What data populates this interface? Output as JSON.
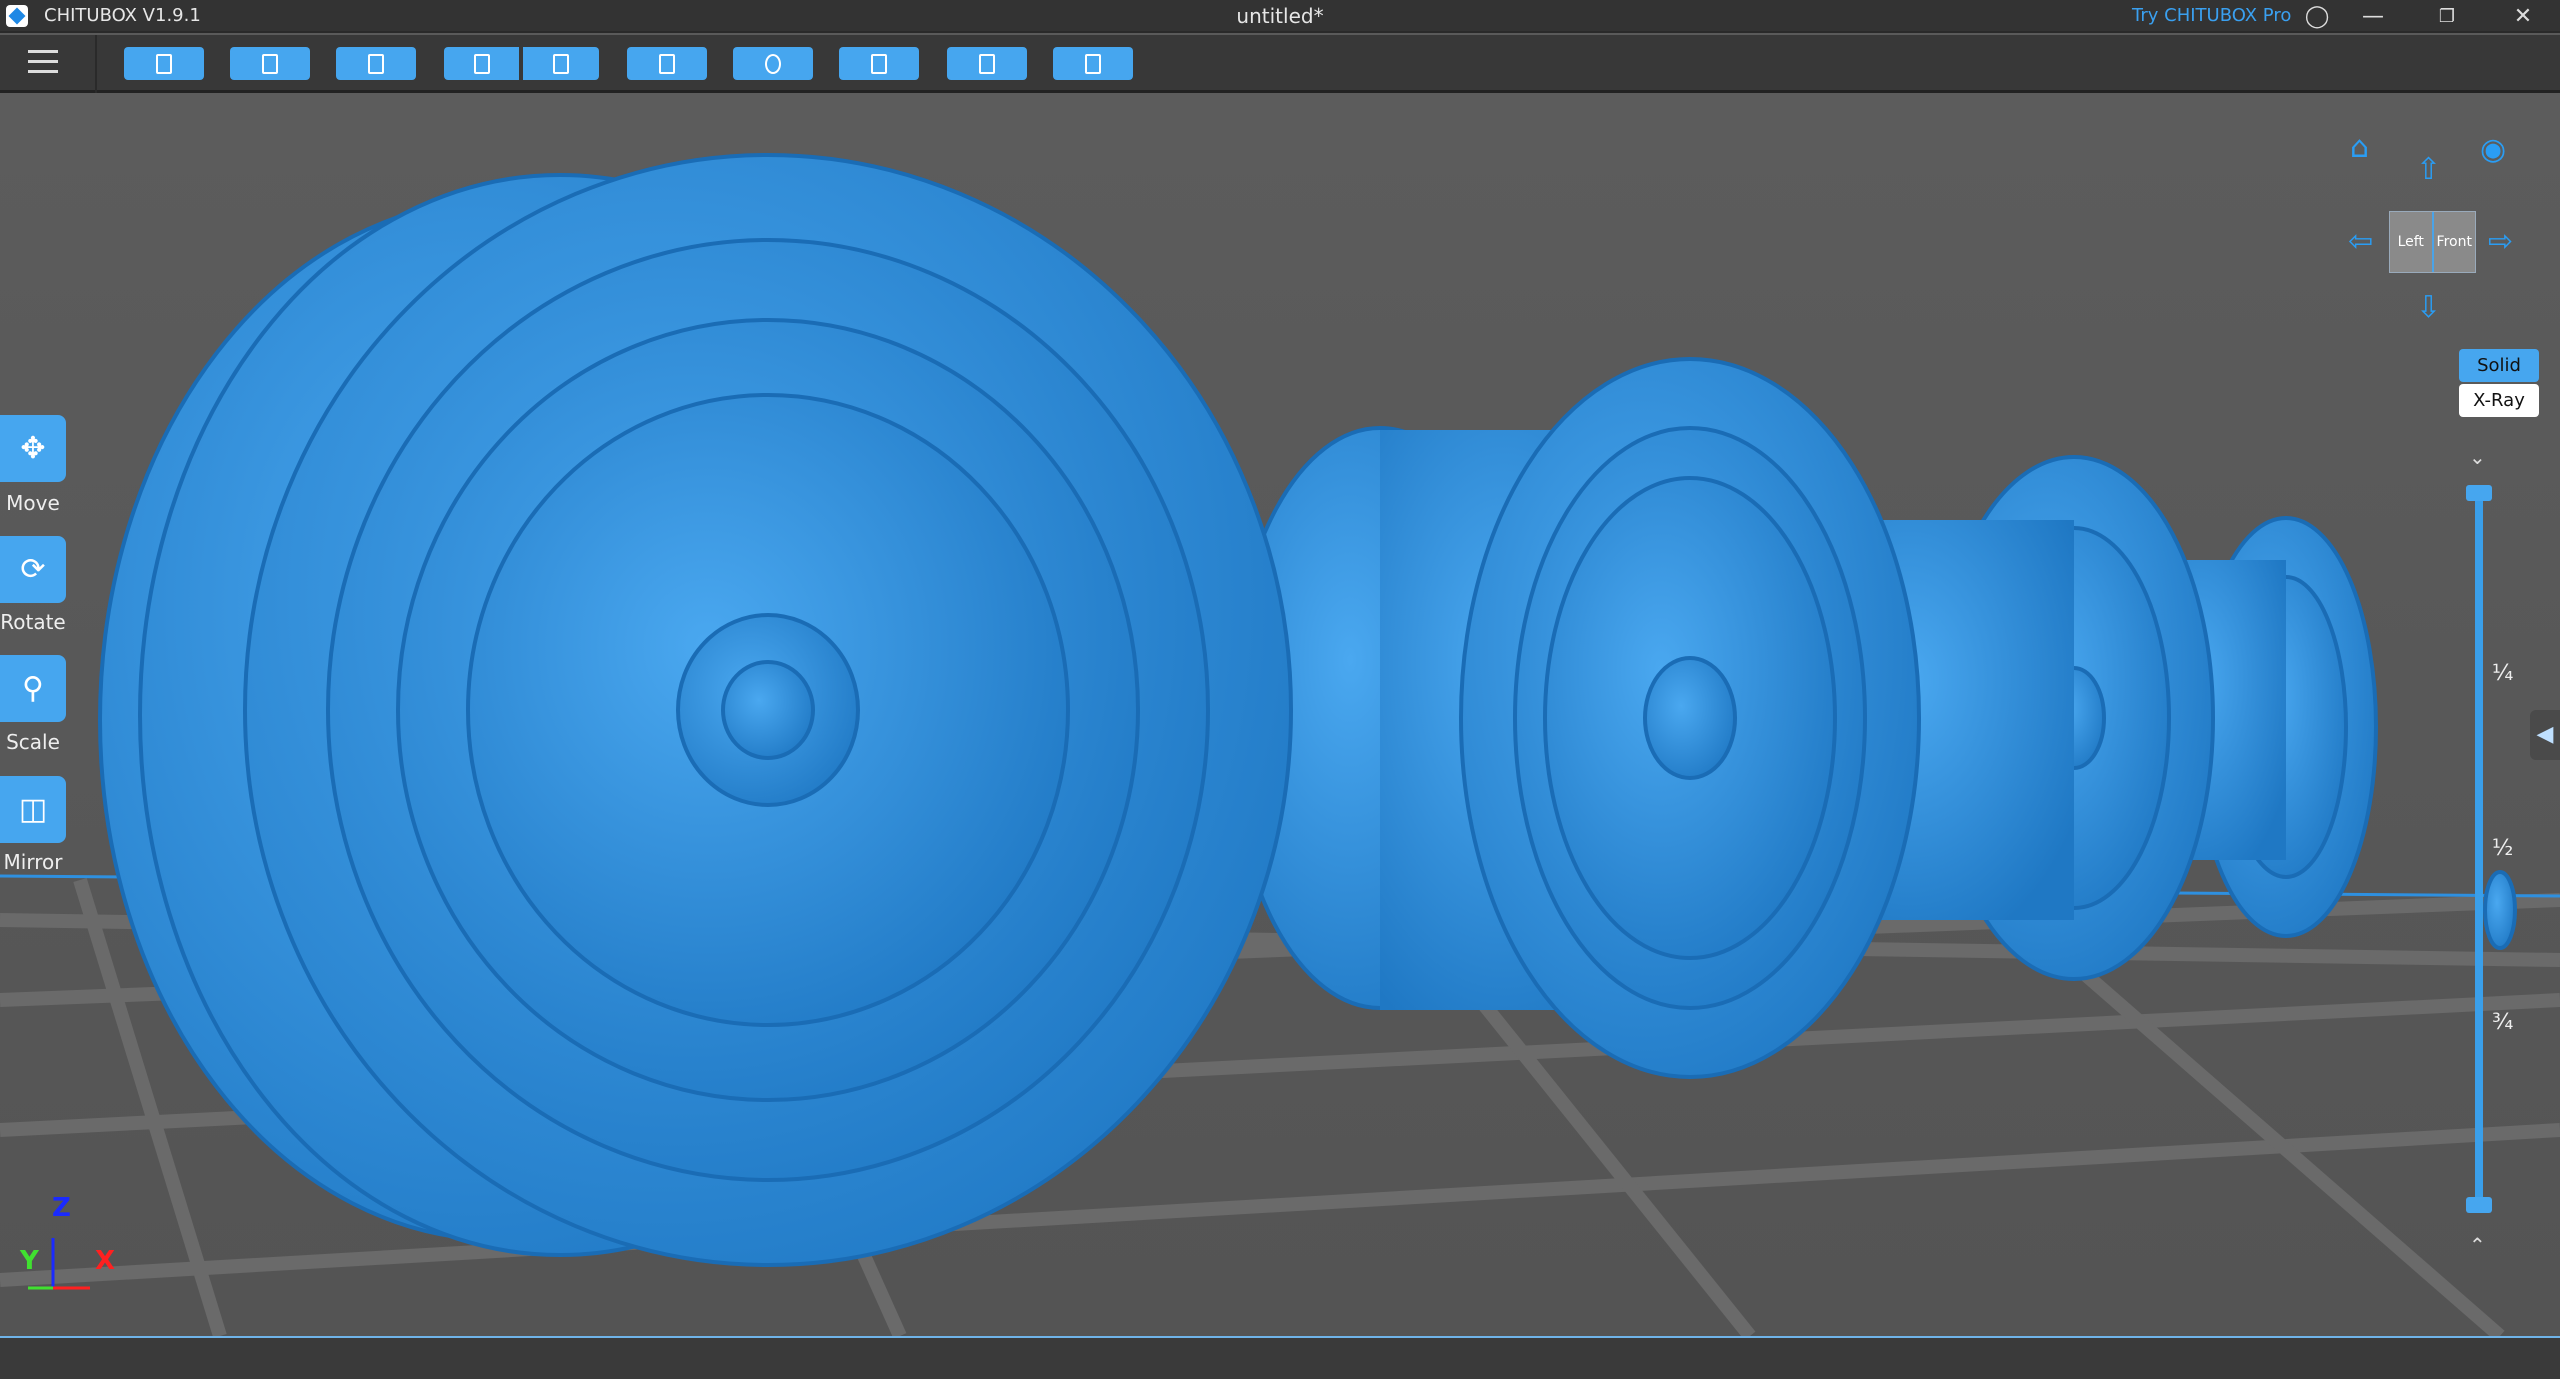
{
  "titlebar": {
    "app_name": "CHITUBOX V1.9.1",
    "document_title": "untitled*",
    "try_pro": "Try CHITUBOX Pro"
  },
  "toolbar": {
    "buttons": [
      "open-file",
      "save",
      "crop",
      "undo",
      "redo",
      "slice-list",
      "support",
      "hollow",
      "dig-hole",
      "settings"
    ]
  },
  "left_tools": [
    {
      "label": "Move"
    },
    {
      "label": "Rotate"
    },
    {
      "label": "Scale"
    },
    {
      "label": "Mirror"
    }
  ],
  "view_cube": {
    "left": "Left",
    "front": "Front"
  },
  "render_mode": {
    "solid": "Solid",
    "xray": "X-Ray",
    "selected": "Solid"
  },
  "layer_slider": {
    "marks": [
      "¼",
      "½",
      "¾"
    ]
  },
  "axes": {
    "z": "Z",
    "y": "Y",
    "x": "X"
  },
  "colors": {
    "accent": "#46a6ef",
    "model": "#2f8fdc",
    "axis_x": "#ff2020",
    "axis_y": "#40e030",
    "axis_z": "#1a2aff"
  }
}
